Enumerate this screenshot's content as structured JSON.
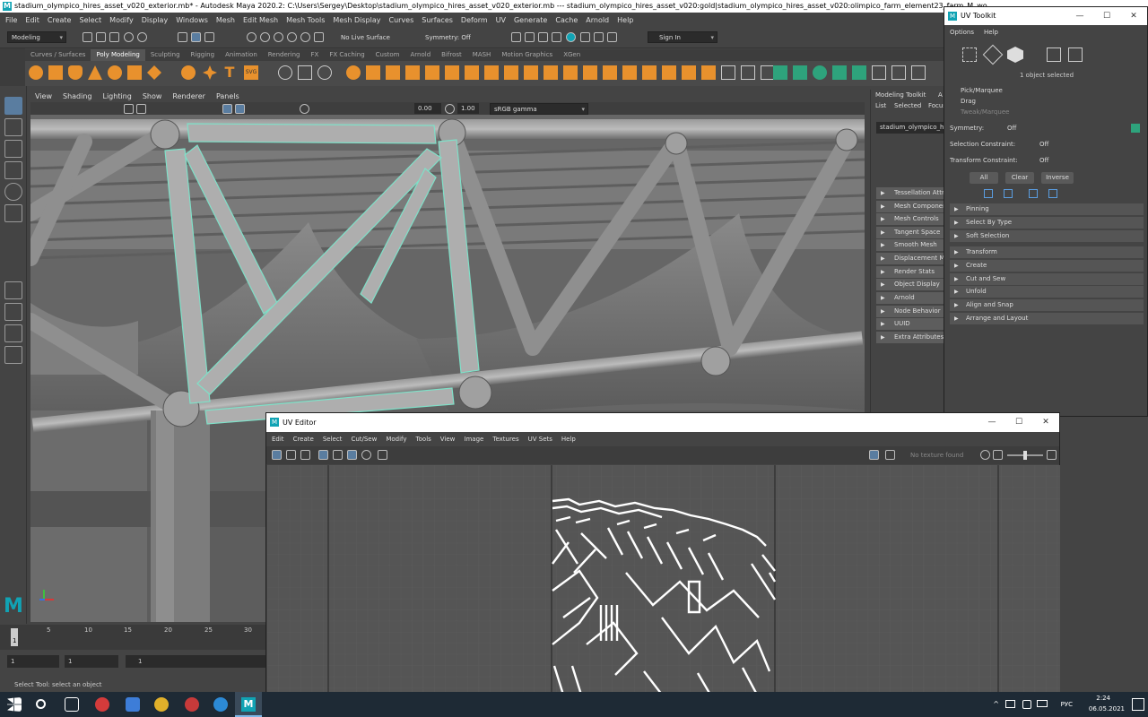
{
  "window": {
    "title": "stadium_olympico_hires_asset_v020_exterior.mb* - Autodesk Maya 2020.2: C:\\Users\\Sergey\\Desktop\\stadium_olympico_hires_asset_v020_exterior.mb  ---  stadium_olympico_hires_asset_v020:gold|stadium_olympico_hires_asset_v020:olimpico_farm_element23_farm_M_wo"
  },
  "menubar": [
    "File",
    "Edit",
    "Create",
    "Select",
    "Modify",
    "Display",
    "Windows",
    "Mesh",
    "Edit Mesh",
    "Mesh Tools",
    "Mesh Display",
    "Curves",
    "Surfaces",
    "Deform",
    "UV",
    "Generate",
    "Cache",
    "Arnold",
    "Help"
  ],
  "statusline": {
    "mode": "Modeling",
    "live_surface": "No Live Surface",
    "symmetry": "Symmetry: Off",
    "sign_in": "Sign In"
  },
  "shelf_tabs": [
    "Curves / Surfaces",
    "Poly Modeling",
    "Sculpting",
    "Rigging",
    "Animation",
    "Rendering",
    "FX",
    "FX Caching",
    "Custom",
    "Arnold",
    "Bifrost",
    "MASH",
    "Motion Graphics",
    "XGen"
  ],
  "viewport": {
    "menu": [
      "View",
      "Shading",
      "Lighting",
      "Show",
      "Renderer",
      "Panels"
    ],
    "exposure": "0.00",
    "gamma": "1.00",
    "color_space": "sRGB gamma"
  },
  "attribute_editor": {
    "tabs": [
      "Modeling Toolkit",
      "A"
    ],
    "list_items": [
      "List",
      "Selected",
      "Focus"
    ],
    "node_name": "stadium_olympico_hi",
    "sections": [
      "Tessellation Attr",
      "Mesh Component",
      "Mesh Controls",
      "Tangent Space",
      "Smooth Mesh",
      "Displacement M",
      "Render Stats",
      "Object Display",
      "Arnold",
      "Node Behavior",
      "UUID",
      "Extra Attributes"
    ]
  },
  "uv_toolkit": {
    "title": "UV Toolkit",
    "menu": [
      "Options",
      "Help"
    ],
    "selected_count": "1 object selected",
    "modes": [
      "Pick/Marquee",
      "Drag",
      "Tweak/Marquee"
    ],
    "symmetry_label": "Symmetry:",
    "symmetry_value": "Off",
    "sel_constraint_label": "Selection Constraint:",
    "sel_constraint_value": "Off",
    "transform_constraint_label": "Transform Constraint:",
    "transform_constraint_value": "Off",
    "buttons": [
      "All",
      "Clear",
      "Inverse"
    ],
    "sections": [
      "Pinning",
      "Select By Type",
      "Soft Selection",
      "Transform",
      "Create",
      "Cut and Sew",
      "Unfold",
      "Align and Snap",
      "Arrange and Layout"
    ]
  },
  "uv_editor": {
    "title": "UV Editor",
    "menu": [
      "Edit",
      "Create",
      "Select",
      "Cut/Sew",
      "Modify",
      "Tools",
      "View",
      "Image",
      "Textures",
      "UV Sets",
      "Help"
    ],
    "texture_status": "No texture found"
  },
  "timeline": {
    "ticks": [
      "1",
      "5",
      "10",
      "15",
      "20",
      "25",
      "30"
    ],
    "current_frame": "1",
    "range_start": "1",
    "range_inner": "1",
    "range_end": "1"
  },
  "help_line": "Select Tool: select an object",
  "taskbar": {
    "language": "РУС",
    "time": "2:24",
    "date": "06.05.2021"
  },
  "colors": {
    "maya_teal": "#11a3b4",
    "shelf_orange": "#e8912d",
    "selection_highlight": "#7fe0c8"
  }
}
